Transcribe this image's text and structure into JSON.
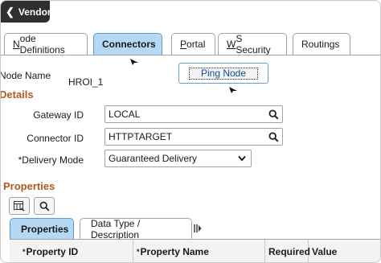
{
  "header": {
    "back_label": "Vendor"
  },
  "tabs": [
    {
      "label": "Node Definitions",
      "underline": "N",
      "rest": "ode Definitions",
      "active": false
    },
    {
      "label": "Connectors",
      "underline": "",
      "rest": "Connectors",
      "active": true
    },
    {
      "label": "Portal",
      "underline": "P",
      "rest": "ortal",
      "active": false
    },
    {
      "label": "WS Security",
      "underline": "W",
      "rest": "S Security",
      "active": false
    },
    {
      "label": "Routings",
      "underline": "",
      "rest": "Routings",
      "active": false
    }
  ],
  "node": {
    "label": "Node Name",
    "value": "HROI_1",
    "ping_label": "Ping Node"
  },
  "details": {
    "title": "Details",
    "gateway_label": "Gateway ID",
    "gateway_value": "LOCAL",
    "connector_label": "Connector ID",
    "connector_value": "HTTPTARGET",
    "delivery_label": "*Delivery Mode",
    "delivery_value": "Guaranteed Delivery"
  },
  "properties": {
    "title": "Properties",
    "grid_tabs": [
      {
        "label": "Properties",
        "active": true
      },
      {
        "label": "Data Type / Description",
        "active": false
      }
    ],
    "columns": [
      {
        "label": "Property ID",
        "required": true
      },
      {
        "label": "Property Name",
        "required": true
      },
      {
        "label": "Required",
        "required": false
      },
      {
        "label": "Value",
        "required": false
      }
    ]
  },
  "colors": {
    "active_tab": "#b5d9f5",
    "section_title": "#b0591f",
    "header_bar": "#2f2f2f",
    "link": "#0b4f9c"
  },
  "icons": [
    "chevron-left-icon",
    "search-icon",
    "chevron-down-icon",
    "grid-view-icon",
    "column-expand-icon"
  ]
}
